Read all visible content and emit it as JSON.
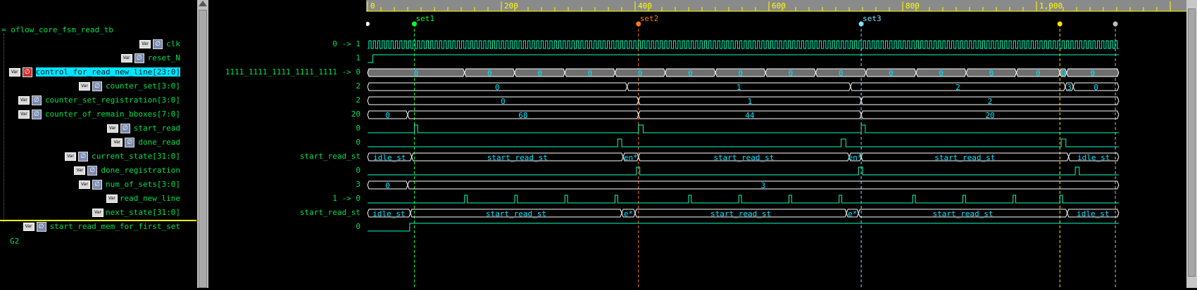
{
  "tree": {
    "root": "oflow_core_fsm_read_tb",
    "group": "G2"
  },
  "signals": [
    {
      "name": "clk",
      "value": "0 -> 1",
      "badges": [
        "Var",
        "wire"
      ],
      "indent": 2
    },
    {
      "name": "reset_N",
      "value": "1",
      "badges": [
        "Var",
        "wire"
      ],
      "indent": 2
    },
    {
      "name": "control_for_read_new_line[23:0]",
      "value": "1111_1111_1111_1111_1111 -> 0",
      "badges": [
        "Var",
        "reg"
      ],
      "indent": 1,
      "selected": true
    },
    {
      "name": "counter_set[3:0]",
      "value": "2",
      "badges": [
        "Var",
        "wire"
      ],
      "indent": 2
    },
    {
      "name": "counter_set_registration[3:0]",
      "value": "2",
      "badges": [
        "Var",
        "wire"
      ],
      "indent": 1
    },
    {
      "name": "counter_of_remain_bboxes[7:0]",
      "value": "20",
      "badges": [
        "Var",
        "wire"
      ],
      "indent": 1
    },
    {
      "name": "start_read",
      "value": "0",
      "badges": [
        "Var",
        "wire"
      ],
      "indent": 2
    },
    {
      "name": "done_read",
      "value": "0",
      "badges": [
        "Var",
        "wire"
      ],
      "indent": 2
    },
    {
      "name": "current_state[31:0]",
      "value": "start_read_st",
      "badges": [
        "Var",
        "wire"
      ],
      "indent": 2
    },
    {
      "name": "done_registration",
      "value": "0",
      "badges": [
        "Var",
        "wire"
      ],
      "indent": 2
    },
    {
      "name": "num_of_sets[3:0]",
      "value": "3",
      "badges": [
        "Var",
        "wire"
      ],
      "indent": 2
    },
    {
      "name": "read_new_line",
      "value": "1 -> 0",
      "badges": [
        "Var"
      ],
      "indent": 2
    },
    {
      "name": "next_state[31:0]",
      "value": "start_read_st",
      "badges": [
        "Var"
      ],
      "indent": 2
    },
    {
      "name": "start_read_mem_for_first_set",
      "value": "0",
      "badges": [
        "Var",
        "wire"
      ],
      "indent": 1
    }
  ],
  "ruler": {
    "ticks": [
      "0",
      "200",
      "400",
      "600",
      "800",
      "1,000"
    ]
  },
  "markers": [
    {
      "label": "set1",
      "color": "#00ff33"
    },
    {
      "label": "set2",
      "color": "#ff7a1a"
    },
    {
      "label": "set3",
      "color": "#80e0ff"
    },
    {
      "label": "",
      "color": "#ffe000"
    },
    {
      "label": "",
      "color": "#bfbfbf"
    }
  ],
  "bus_labels": {
    "control": [
      "0",
      "0",
      "0",
      "0",
      "0",
      "0",
      "0",
      "0",
      "0",
      "0",
      "0",
      "0",
      "0",
      "0",
      "0"
    ],
    "counter_set": [
      "0",
      "1",
      "2",
      "3",
      "0"
    ],
    "counter_set_registration": [
      "0",
      "1",
      "2"
    ],
    "counter_of_remain_bboxes": [
      "0",
      "68",
      "44",
      "20"
    ],
    "current_state": [
      "idle_st",
      "start_read_st",
      "en*",
      "start_read_st",
      "en*",
      "start_read_st",
      "idle_st"
    ],
    "num_of_sets": [
      "0",
      "3"
    ],
    "next_state": [
      "idle_st",
      "start_read_st",
      "e*",
      "start_read_st",
      "e*",
      "start_read_st",
      "idle_st"
    ]
  },
  "colors": {
    "wave": "#00ffbf",
    "bus": "#ffffff",
    "accent": "#00e5ff",
    "label": "#00e050"
  }
}
